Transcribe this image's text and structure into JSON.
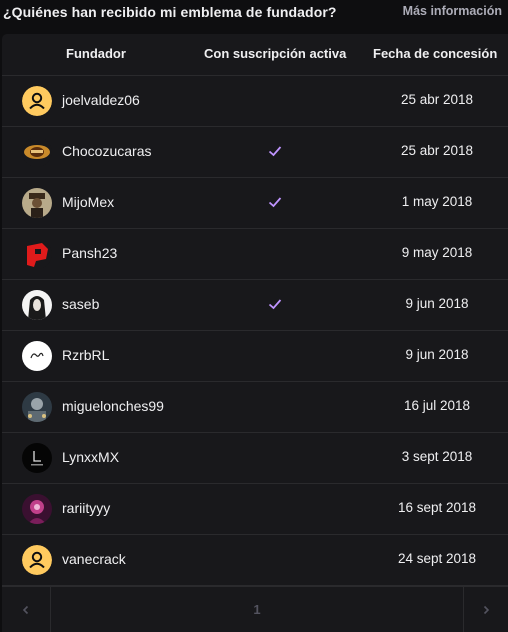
{
  "header": {
    "title": "¿Quiénes han recibido mi emblema de fundador?",
    "more_info": "Más información"
  },
  "table": {
    "columns": [
      "Fundador",
      "Con suscripción activa",
      "Fecha de concesión"
    ],
    "rows": [
      {
        "name": "joelvaldez06",
        "active": false,
        "date": "25 abr 2018",
        "avatar": "default-user-icon"
      },
      {
        "name": "Chocozucaras",
        "active": true,
        "date": "25 abr 2018",
        "avatar": "chocozucaras-avatar"
      },
      {
        "name": "MijoMex",
        "active": true,
        "date": "1 may 2018",
        "avatar": "mijomex-avatar"
      },
      {
        "name": "Pansh23",
        "active": false,
        "date": "9 may 2018",
        "avatar": "pansh23-avatar"
      },
      {
        "name": "saseb",
        "active": true,
        "date": "9 jun 2018",
        "avatar": "saseb-avatar"
      },
      {
        "name": "RzrbRL",
        "active": false,
        "date": "9 jun 2018",
        "avatar": "rzrbrl-avatar"
      },
      {
        "name": "miguelonches99",
        "active": false,
        "date": "16 jul 2018",
        "avatar": "miguelonches99-avatar"
      },
      {
        "name": "LynxxMX",
        "active": false,
        "date": "3 sept 2018",
        "avatar": "lynxxmx-avatar"
      },
      {
        "name": "rariityyy",
        "active": false,
        "date": "16 sept 2018",
        "avatar": "rariityyy-avatar"
      },
      {
        "name": "vanecrack",
        "active": false,
        "date": "24 sept 2018",
        "avatar": "default-user-icon"
      }
    ]
  },
  "pagination": {
    "current_page": "1",
    "prev_icon": "chevron-left-icon",
    "next_icon": "chevron-right-icon"
  },
  "colors": {
    "background": "#0e0e10",
    "card": "#18181b",
    "check": "#bf94ff",
    "default_avatar": "#ffca5f"
  }
}
